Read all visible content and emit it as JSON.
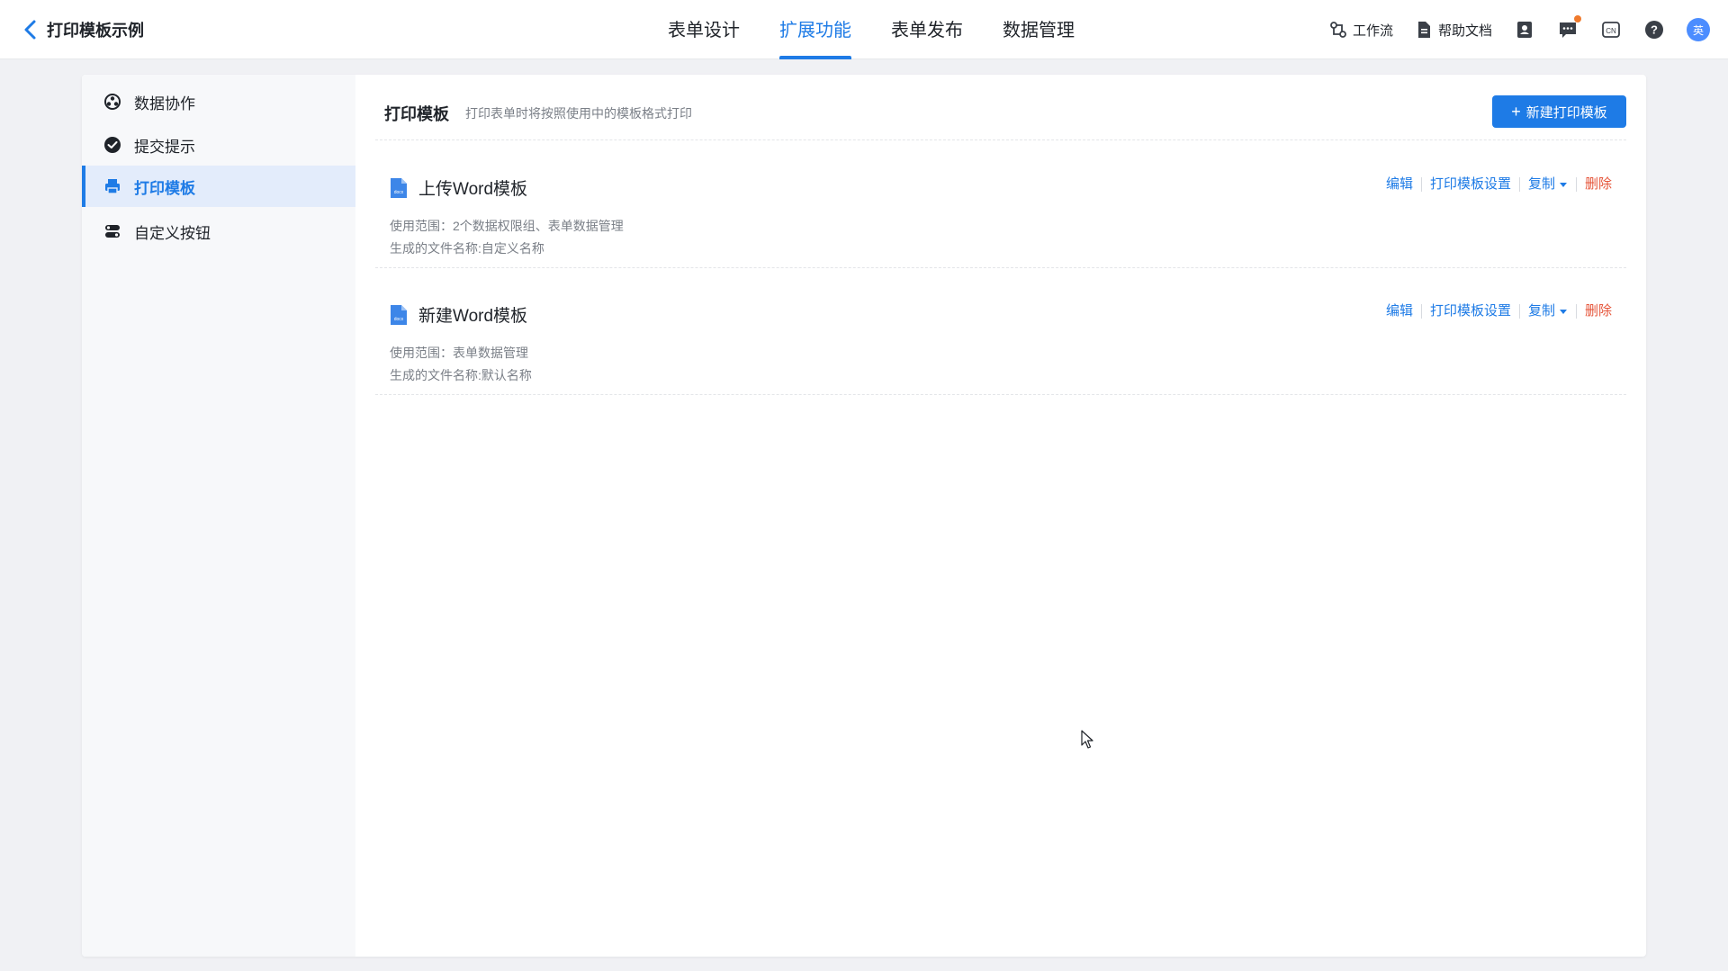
{
  "header": {
    "title": "打印模板示例",
    "tabs": [
      {
        "label": "表单设计"
      },
      {
        "label": "扩展功能",
        "active": true
      },
      {
        "label": "表单发布"
      },
      {
        "label": "数据管理"
      }
    ],
    "tools": {
      "workflow_label": "工作流",
      "help_label": "帮助文档",
      "lang_label": "CN",
      "avatar_text": "英"
    }
  },
  "sidebar": {
    "items": [
      {
        "label": "数据协作",
        "icon": "data-collab-icon"
      },
      {
        "label": "提交提示",
        "icon": "check-circle-icon"
      },
      {
        "label": "打印模板",
        "icon": "printer-icon",
        "active": true
      },
      {
        "label": "自定义按钮",
        "icon": "custom-button-icon"
      }
    ]
  },
  "content": {
    "title": "打印模板",
    "description": "打印表单时将按照使用中的模板格式打印",
    "new_button": "新建打印模板",
    "templates": [
      {
        "name": "上传Word模板",
        "scope": "使用范围：2个数据权限组、表单数据管理",
        "filename": "生成的文件名称:自定义名称"
      },
      {
        "name": "新建Word模板",
        "scope": "使用范围：表单数据管理",
        "filename": "生成的文件名称:默认名称"
      }
    ],
    "actions": {
      "edit": "编辑",
      "settings": "打印模板设置",
      "copy": "复制",
      "delete": "删除"
    }
  },
  "colors": {
    "accent": "#1e7be6",
    "danger": "#e5553a",
    "notification_dot": "#f07a2c"
  }
}
